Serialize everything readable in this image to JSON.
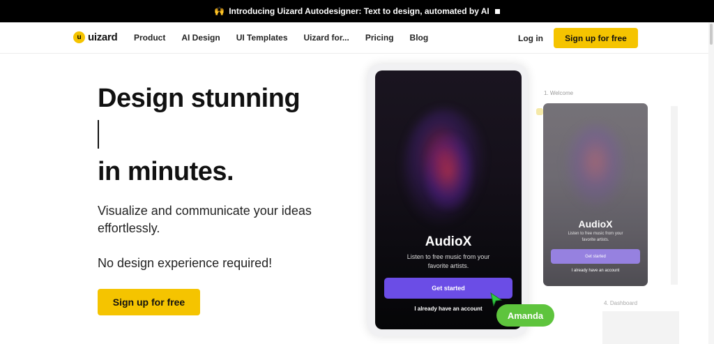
{
  "announcement": {
    "icon": "raised-hands-icon",
    "text": "Introducing Uizard Autodesigner: Text to design, automated by AI"
  },
  "nav": {
    "logo_text": "uizard",
    "logo_mark": "u",
    "links": [
      "Product",
      "AI Design",
      "UI Templates",
      "Uizard for...",
      "Pricing",
      "Blog"
    ],
    "login": "Log in",
    "signup": "Sign up for free"
  },
  "hero": {
    "title_line1": "Design stunning",
    "title_line2": "in minutes.",
    "subtitle": "Visualize and communicate your ideas effortlessly.",
    "note": "No design experience required!",
    "cta": "Sign up for free"
  },
  "mockup": {
    "app_name": "AudioX",
    "app_tagline": "Listen to free music from your favorite artists.",
    "primary_button": "Get started",
    "secondary_link": "I already have an account",
    "collaborator": "Amanda",
    "collaborator_color": "#5ec43d"
  },
  "side_screens": {
    "label1": "1. Welcome",
    "app_name": "AudioX",
    "app_tagline": "Listen to free music from your favorite artists.",
    "primary_button": "Get started",
    "secondary_link": "I already have an account",
    "label2": "4. Dashboard"
  },
  "colors": {
    "accent": "#f5c400",
    "primary_purple": "#6b4de6",
    "announcement_bg": "#000000"
  }
}
